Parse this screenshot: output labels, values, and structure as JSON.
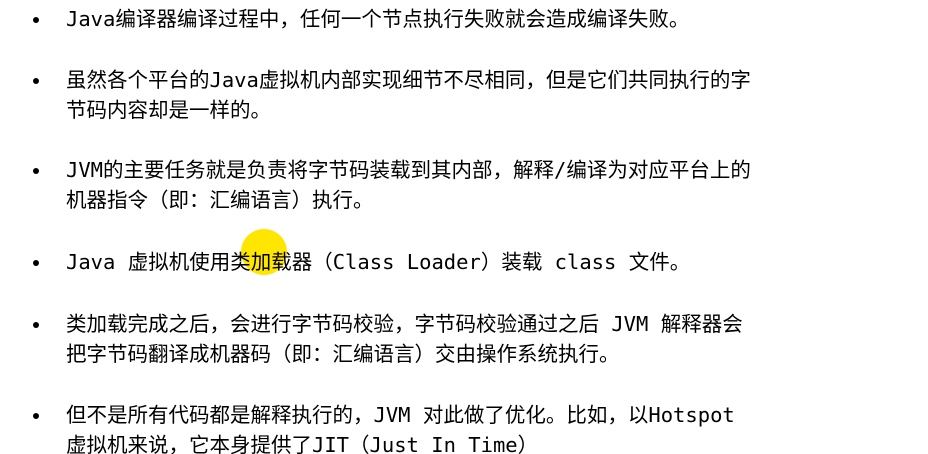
{
  "slide": {
    "highlight_color": "#FFE600",
    "bullets": [
      {
        "lines": [
          "Java编译器编译过程中，任何一个节点执行失败就会造成编译失败。"
        ]
      },
      {
        "lines": [
          "虽然各个平台的Java虚拟机内部实现细节不尽相同，但是它们共同执行的字",
          "节码内容却是一样的。"
        ]
      },
      {
        "lines": [
          "JVM的主要任务就是负责将字节码装载到其内部，解释/编译为对应平台上的",
          "机器指令（即：汇编语言）执行。"
        ]
      },
      {
        "lines": [
          "Java 虚拟机使用类加载器（Class Loader）装载 class 文件。"
        ]
      },
      {
        "lines": [
          "类加载完成之后，会进行字节码校验，字节码校验通过之后 JVM 解释器会",
          "把字节码翻译成机器码（即：汇编语言）交由操作系统执行。"
        ]
      },
      {
        "lines": [
          "但不是所有代码都是解释执行的，JVM 对此做了优化。比如，以Hotspot",
          "虚拟机来说，它本身提供了JIT（Just In Time）"
        ]
      }
    ]
  }
}
